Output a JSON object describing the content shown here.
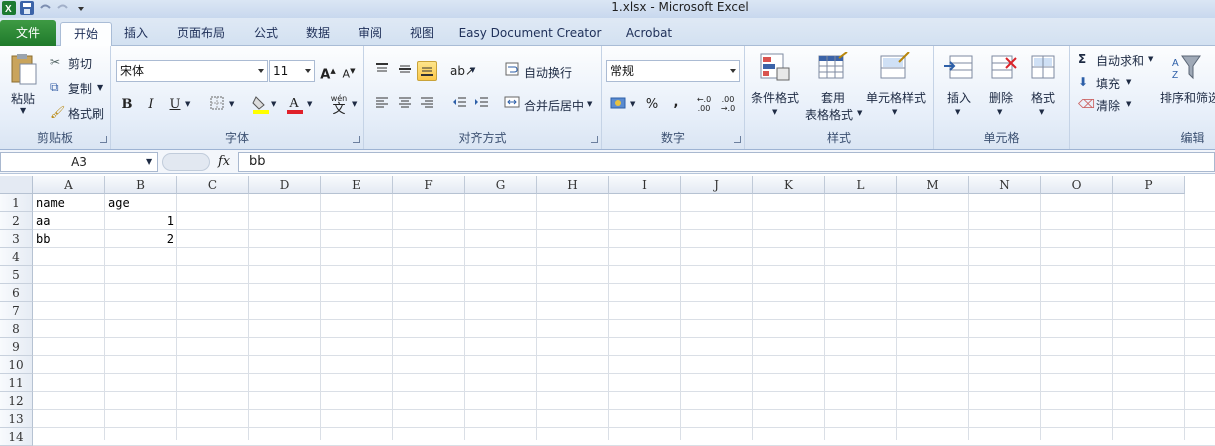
{
  "window": {
    "title": "1.xlsx  -  Microsoft Excel"
  },
  "tabs": [
    "文件",
    "开始",
    "插入",
    "页面布局",
    "公式",
    "数据",
    "审阅",
    "视图",
    "Easy Document Creator",
    "Acrobat"
  ],
  "ribbon": {
    "clipboard": {
      "paste": "粘贴",
      "cut": "剪切",
      "copy": "复制",
      "format_painter": "格式刷",
      "label": "剪贴板"
    },
    "font": {
      "name": "宋体",
      "size": "11",
      "label": "字体",
      "bold": "B",
      "italic": "I",
      "underline": "U",
      "grow": "A",
      "shrink": "A",
      "wen": "wén",
      "wen_char": "文"
    },
    "alignment": {
      "wrap": "自动换行",
      "merge": "合并后居中",
      "label": "对齐方式"
    },
    "number": {
      "format": "常规",
      "label": "数字",
      "percent": "%",
      "comma": ","
    },
    "styles": {
      "conditional": "条件格式",
      "table1": "套用",
      "table2": "表格格式",
      "cell_styles": "单元格样式",
      "label": "样式"
    },
    "cells": {
      "insert": "插入",
      "delete": "删除",
      "format": "格式",
      "label": "单元格"
    },
    "editing": {
      "autosum": "自动求和",
      "fill": "填充",
      "clear": "清除",
      "sort": "排序和筛选",
      "label": "编辑"
    }
  },
  "formula_bar": {
    "name_box": "A3",
    "fx": "fx",
    "value": "bb"
  },
  "columns": [
    "A",
    "B",
    "C",
    "D",
    "E",
    "F",
    "G",
    "H",
    "I",
    "J",
    "K",
    "L",
    "M",
    "N",
    "O",
    "P"
  ],
  "rows": [
    "1",
    "2",
    "3",
    "4",
    "5",
    "6",
    "7",
    "8",
    "9",
    "10",
    "11",
    "12",
    "13",
    "14"
  ],
  "cells": {
    "A1": "name",
    "B1": "age",
    "A2": "aa",
    "B2": "1",
    "A3": "bb",
    "B3": "2"
  },
  "colors": {
    "file_tab": "#1f7a2b",
    "ribbon_bg": "#e6eef9",
    "selected_btn": "#fbc84a"
  }
}
